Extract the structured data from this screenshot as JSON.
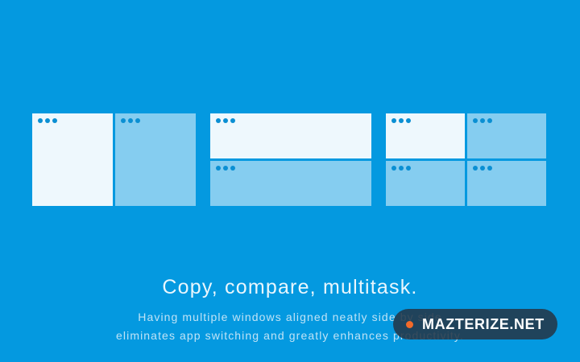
{
  "headline": "Copy, compare, multitask.",
  "description_line1": "Having multiple windows aligned neatly side by side",
  "description_line2": "eliminates app switching and greatly enhances productivity.",
  "watermark": {
    "text": "MAZTERIZE.NET"
  },
  "layout_options": [
    {
      "name": "split-vertical",
      "windows": [
        {
          "style": "solid"
        },
        {
          "style": "faded"
        }
      ]
    },
    {
      "name": "split-horizontal",
      "windows": [
        {
          "style": "solid"
        },
        {
          "style": "faded"
        }
      ]
    },
    {
      "name": "grid-four",
      "windows": [
        {
          "style": "solid"
        },
        {
          "style": "faded"
        },
        {
          "style": "faded"
        },
        {
          "style": "faded"
        }
      ]
    }
  ],
  "colors": {
    "background": "#0499e0",
    "window_active": "#eef8fd",
    "window_inactive": "#85cdf0",
    "window_dots": "#0a8fd3",
    "watermark_bg": "#243748",
    "watermark_dot": "#f26a2a"
  }
}
